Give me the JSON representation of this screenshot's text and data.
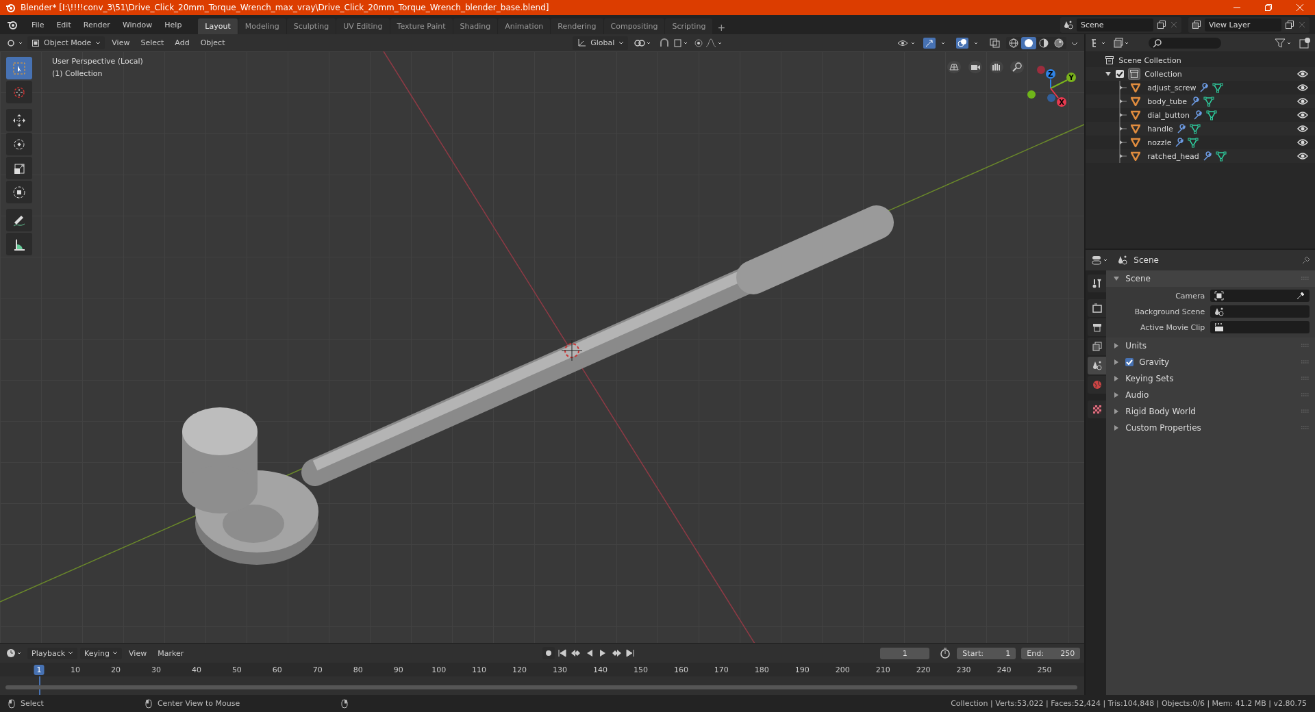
{
  "title_bar": {
    "title": "Blender* [I:\\!!!!conv_3\\51\\Drive_Click_20mm_Torque_Wrench_max_vray\\Drive_Click_20mm_Torque_Wrench_blender_base.blend]"
  },
  "menu": [
    "File",
    "Edit",
    "Render",
    "Window",
    "Help"
  ],
  "workspaces": [
    {
      "label": "Layout",
      "selected": true
    },
    {
      "label": "Modeling",
      "selected": false
    },
    {
      "label": "Sculpting",
      "selected": false
    },
    {
      "label": "UV Editing",
      "selected": false
    },
    {
      "label": "Texture Paint",
      "selected": false
    },
    {
      "label": "Shading",
      "selected": false
    },
    {
      "label": "Animation",
      "selected": false
    },
    {
      "label": "Rendering",
      "selected": false
    },
    {
      "label": "Compositing",
      "selected": false
    },
    {
      "label": "Scripting",
      "selected": false
    }
  ],
  "add_workspace": "+",
  "scene_field": "Scene",
  "view_layer_field": "View Layer",
  "viewport_header": {
    "mode": "Object Mode",
    "menus": [
      "View",
      "Select",
      "Add",
      "Object"
    ],
    "orientation": "Global",
    "shading": [
      {
        "kind": "wireframe",
        "selected": false
      },
      {
        "kind": "solid",
        "selected": true
      },
      {
        "kind": "material",
        "selected": false
      },
      {
        "kind": "rendered",
        "selected": false
      }
    ]
  },
  "viewport": {
    "view_name": "User Perspective (Local)",
    "collection": "(1) Collection",
    "tools": [
      {
        "kind": "select",
        "selected": true
      },
      {
        "kind": "cursor",
        "selected": false
      },
      {
        "kind": "move",
        "selected": false
      },
      {
        "kind": "rotate",
        "selected": false
      },
      {
        "kind": "scale",
        "selected": false
      },
      {
        "kind": "transform",
        "selected": false
      },
      {
        "kind": "annotate",
        "selected": false
      },
      {
        "kind": "measure",
        "selected": false
      }
    ],
    "gizmo": [
      {
        "label": "Z",
        "color": "#2f83e6"
      },
      {
        "label": "Y",
        "color": "#7ab31c"
      },
      {
        "label": "X",
        "color": "#e8394f"
      }
    ]
  },
  "outliner": {
    "root": "Scene Collection",
    "collections": [
      {
        "name": "Collection",
        "checked": true,
        "expanded": true,
        "children": [
          {
            "name": "adjust_screw"
          },
          {
            "name": "body_tube"
          },
          {
            "name": "dial_button"
          },
          {
            "name": "handle"
          },
          {
            "name": "nozzle"
          },
          {
            "name": "ratched_head"
          }
        ]
      }
    ]
  },
  "properties": {
    "header": "Scene",
    "tabs": [
      {
        "kind": "tool",
        "selected": false
      },
      {
        "kind": "render",
        "selected": false
      },
      {
        "kind": "output",
        "selected": false
      },
      {
        "kind": "view_layer",
        "selected": false
      },
      {
        "kind": "scene",
        "selected": true
      },
      {
        "kind": "world",
        "selected": false
      },
      {
        "kind": "texture",
        "selected": false
      }
    ],
    "panels": [
      {
        "title": "Scene",
        "kind": "plain",
        "expanded": true,
        "fields": [
          {
            "label": "Camera",
            "kind": "camera"
          },
          {
            "label": "Background Scene",
            "kind": "scene"
          },
          {
            "label": "Active Movie Clip",
            "kind": "clip"
          }
        ]
      },
      {
        "title": "Units",
        "kind": "plain",
        "expanded": false
      },
      {
        "title": "Gravity",
        "kind": "checkbox",
        "checked": true,
        "expanded": false
      },
      {
        "title": "Keying Sets",
        "kind": "plain",
        "expanded": false
      },
      {
        "title": "Audio",
        "kind": "plain",
        "expanded": false
      },
      {
        "title": "Rigid Body World",
        "kind": "plain",
        "expanded": false
      },
      {
        "title": "Custom Properties",
        "kind": "plain",
        "expanded": false
      }
    ]
  },
  "timeline": {
    "menus": [
      "Playback",
      "Keying",
      "View",
      "Marker"
    ],
    "current_frame": "1",
    "start_label": "Start:",
    "start": "1",
    "end_label": "End:",
    "end": "250",
    "ruler": [
      {
        "label": "1",
        "selected": true
      },
      {
        "label": "10",
        "selected": false
      },
      {
        "label": "20",
        "selected": false
      },
      {
        "label": "30",
        "selected": false
      },
      {
        "label": "40",
        "selected": false
      },
      {
        "label": "50",
        "selected": false
      },
      {
        "label": "60",
        "selected": false
      },
      {
        "label": "70",
        "selected": false
      },
      {
        "label": "80",
        "selected": false
      },
      {
        "label": "90",
        "selected": false
      },
      {
        "label": "100",
        "selected": false
      },
      {
        "label": "110",
        "selected": false
      },
      {
        "label": "120",
        "selected": false
      },
      {
        "label": "130",
        "selected": false
      },
      {
        "label": "140",
        "selected": false
      },
      {
        "label": "150",
        "selected": false
      },
      {
        "label": "160",
        "selected": false
      },
      {
        "label": "170",
        "selected": false
      },
      {
        "label": "180",
        "selected": false
      },
      {
        "label": "190",
        "selected": false
      },
      {
        "label": "200",
        "selected": false
      },
      {
        "label": "210",
        "selected": false
      },
      {
        "label": "220",
        "selected": false
      },
      {
        "label": "230",
        "selected": false
      },
      {
        "label": "240",
        "selected": false
      },
      {
        "label": "250",
        "selected": false
      }
    ]
  },
  "status_bar": {
    "hints": [
      "Select",
      "Center View to Mouse"
    ],
    "stats": "Collection | Verts:53,022 | Faces:52,424 | Tris:104,848 | Objects:0/6 | Mem: 41.2 MB | v2.80.75"
  }
}
